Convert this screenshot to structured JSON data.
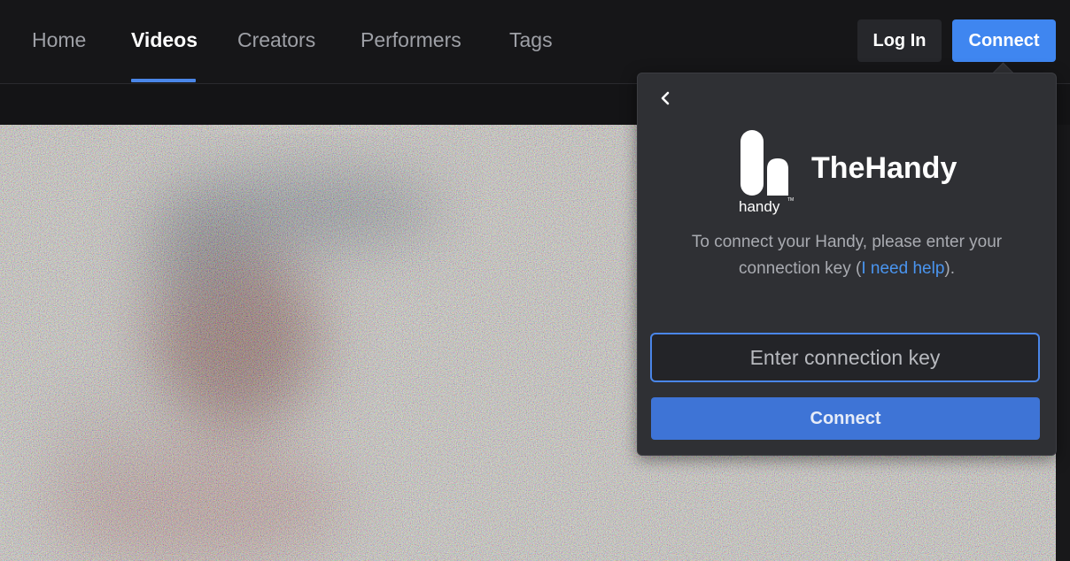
{
  "nav": {
    "items": [
      {
        "label": "Home",
        "active": false
      },
      {
        "label": "Videos",
        "active": true
      },
      {
        "label": "Creators",
        "active": false
      },
      {
        "label": "Performers",
        "active": false
      },
      {
        "label": "Tags",
        "active": false
      }
    ],
    "login_label": "Log In",
    "connect_label": "Connect"
  },
  "popover": {
    "back_icon": "chevron-left-icon",
    "logo_text": "handy",
    "logo_tm": "TM",
    "brand_name": "TheHandy",
    "instruction_before": "To connect your Handy, please enter your connection key (",
    "help_link": "I need help",
    "instruction_after": ").",
    "input_placeholder": "Enter connection key",
    "input_value": "",
    "connect_label": "Connect"
  },
  "colors": {
    "accent": "#3f86f0",
    "link": "#4a95f0",
    "background": "#161618",
    "popover": "#2f3034"
  }
}
